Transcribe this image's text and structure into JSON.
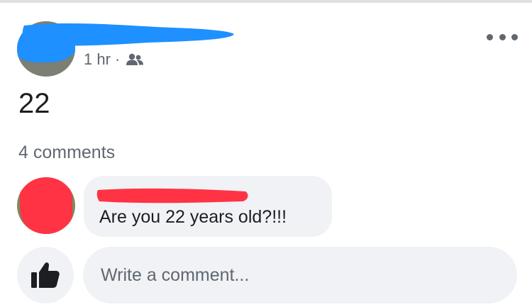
{
  "post": {
    "time": "1 hr",
    "separator": "·",
    "audience_icon": "friends-icon",
    "text": "22",
    "more_icon": "more-horizontal-icon"
  },
  "comments": {
    "count_label": "4 comments",
    "items": [
      {
        "text": "Are you 22 years old?!!!"
      }
    ]
  },
  "composer": {
    "like_icon": "thumbs-up-icon",
    "placeholder": "Write a comment..."
  },
  "colors": {
    "redaction_blue": "#1e90ff",
    "redaction_red": "#ff3344",
    "secondary_text": "#606770",
    "bubble_bg": "#f0f2f5"
  }
}
